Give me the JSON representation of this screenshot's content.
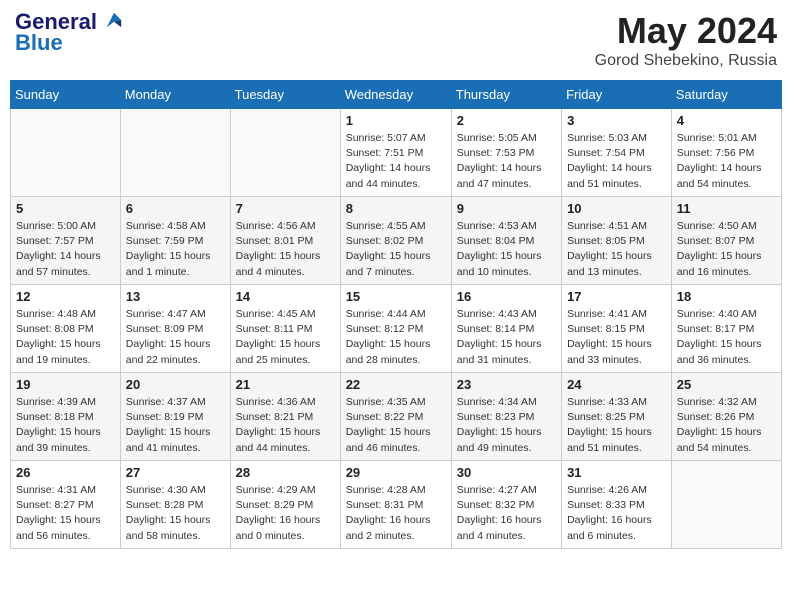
{
  "header": {
    "logo_line1": "General",
    "logo_line2": "Blue",
    "month_title": "May 2024",
    "location": "Gorod Shebekino, Russia"
  },
  "weekdays": [
    "Sunday",
    "Monday",
    "Tuesday",
    "Wednesday",
    "Thursday",
    "Friday",
    "Saturday"
  ],
  "weeks": [
    [
      {
        "day": "",
        "sunrise": "",
        "sunset": "",
        "daylight": ""
      },
      {
        "day": "",
        "sunrise": "",
        "sunset": "",
        "daylight": ""
      },
      {
        "day": "",
        "sunrise": "",
        "sunset": "",
        "daylight": ""
      },
      {
        "day": "1",
        "sunrise": "Sunrise: 5:07 AM",
        "sunset": "Sunset: 7:51 PM",
        "daylight": "Daylight: 14 hours and 44 minutes."
      },
      {
        "day": "2",
        "sunrise": "Sunrise: 5:05 AM",
        "sunset": "Sunset: 7:53 PM",
        "daylight": "Daylight: 14 hours and 47 minutes."
      },
      {
        "day": "3",
        "sunrise": "Sunrise: 5:03 AM",
        "sunset": "Sunset: 7:54 PM",
        "daylight": "Daylight: 14 hours and 51 minutes."
      },
      {
        "day": "4",
        "sunrise": "Sunrise: 5:01 AM",
        "sunset": "Sunset: 7:56 PM",
        "daylight": "Daylight: 14 hours and 54 minutes."
      }
    ],
    [
      {
        "day": "5",
        "sunrise": "Sunrise: 5:00 AM",
        "sunset": "Sunset: 7:57 PM",
        "daylight": "Daylight: 14 hours and 57 minutes."
      },
      {
        "day": "6",
        "sunrise": "Sunrise: 4:58 AM",
        "sunset": "Sunset: 7:59 PM",
        "daylight": "Daylight: 15 hours and 1 minute."
      },
      {
        "day": "7",
        "sunrise": "Sunrise: 4:56 AM",
        "sunset": "Sunset: 8:01 PM",
        "daylight": "Daylight: 15 hours and 4 minutes."
      },
      {
        "day": "8",
        "sunrise": "Sunrise: 4:55 AM",
        "sunset": "Sunset: 8:02 PM",
        "daylight": "Daylight: 15 hours and 7 minutes."
      },
      {
        "day": "9",
        "sunrise": "Sunrise: 4:53 AM",
        "sunset": "Sunset: 8:04 PM",
        "daylight": "Daylight: 15 hours and 10 minutes."
      },
      {
        "day": "10",
        "sunrise": "Sunrise: 4:51 AM",
        "sunset": "Sunset: 8:05 PM",
        "daylight": "Daylight: 15 hours and 13 minutes."
      },
      {
        "day": "11",
        "sunrise": "Sunrise: 4:50 AM",
        "sunset": "Sunset: 8:07 PM",
        "daylight": "Daylight: 15 hours and 16 minutes."
      }
    ],
    [
      {
        "day": "12",
        "sunrise": "Sunrise: 4:48 AM",
        "sunset": "Sunset: 8:08 PM",
        "daylight": "Daylight: 15 hours and 19 minutes."
      },
      {
        "day": "13",
        "sunrise": "Sunrise: 4:47 AM",
        "sunset": "Sunset: 8:09 PM",
        "daylight": "Daylight: 15 hours and 22 minutes."
      },
      {
        "day": "14",
        "sunrise": "Sunrise: 4:45 AM",
        "sunset": "Sunset: 8:11 PM",
        "daylight": "Daylight: 15 hours and 25 minutes."
      },
      {
        "day": "15",
        "sunrise": "Sunrise: 4:44 AM",
        "sunset": "Sunset: 8:12 PM",
        "daylight": "Daylight: 15 hours and 28 minutes."
      },
      {
        "day": "16",
        "sunrise": "Sunrise: 4:43 AM",
        "sunset": "Sunset: 8:14 PM",
        "daylight": "Daylight: 15 hours and 31 minutes."
      },
      {
        "day": "17",
        "sunrise": "Sunrise: 4:41 AM",
        "sunset": "Sunset: 8:15 PM",
        "daylight": "Daylight: 15 hours and 33 minutes."
      },
      {
        "day": "18",
        "sunrise": "Sunrise: 4:40 AM",
        "sunset": "Sunset: 8:17 PM",
        "daylight": "Daylight: 15 hours and 36 minutes."
      }
    ],
    [
      {
        "day": "19",
        "sunrise": "Sunrise: 4:39 AM",
        "sunset": "Sunset: 8:18 PM",
        "daylight": "Daylight: 15 hours and 39 minutes."
      },
      {
        "day": "20",
        "sunrise": "Sunrise: 4:37 AM",
        "sunset": "Sunset: 8:19 PM",
        "daylight": "Daylight: 15 hours and 41 minutes."
      },
      {
        "day": "21",
        "sunrise": "Sunrise: 4:36 AM",
        "sunset": "Sunset: 8:21 PM",
        "daylight": "Daylight: 15 hours and 44 minutes."
      },
      {
        "day": "22",
        "sunrise": "Sunrise: 4:35 AM",
        "sunset": "Sunset: 8:22 PM",
        "daylight": "Daylight: 15 hours and 46 minutes."
      },
      {
        "day": "23",
        "sunrise": "Sunrise: 4:34 AM",
        "sunset": "Sunset: 8:23 PM",
        "daylight": "Daylight: 15 hours and 49 minutes."
      },
      {
        "day": "24",
        "sunrise": "Sunrise: 4:33 AM",
        "sunset": "Sunset: 8:25 PM",
        "daylight": "Daylight: 15 hours and 51 minutes."
      },
      {
        "day": "25",
        "sunrise": "Sunrise: 4:32 AM",
        "sunset": "Sunset: 8:26 PM",
        "daylight": "Daylight: 15 hours and 54 minutes."
      }
    ],
    [
      {
        "day": "26",
        "sunrise": "Sunrise: 4:31 AM",
        "sunset": "Sunset: 8:27 PM",
        "daylight": "Daylight: 15 hours and 56 minutes."
      },
      {
        "day": "27",
        "sunrise": "Sunrise: 4:30 AM",
        "sunset": "Sunset: 8:28 PM",
        "daylight": "Daylight: 15 hours and 58 minutes."
      },
      {
        "day": "28",
        "sunrise": "Sunrise: 4:29 AM",
        "sunset": "Sunset: 8:29 PM",
        "daylight": "Daylight: 16 hours and 0 minutes."
      },
      {
        "day": "29",
        "sunrise": "Sunrise: 4:28 AM",
        "sunset": "Sunset: 8:31 PM",
        "daylight": "Daylight: 16 hours and 2 minutes."
      },
      {
        "day": "30",
        "sunrise": "Sunrise: 4:27 AM",
        "sunset": "Sunset: 8:32 PM",
        "daylight": "Daylight: 16 hours and 4 minutes."
      },
      {
        "day": "31",
        "sunrise": "Sunrise: 4:26 AM",
        "sunset": "Sunset: 8:33 PM",
        "daylight": "Daylight: 16 hours and 6 minutes."
      },
      {
        "day": "",
        "sunrise": "",
        "sunset": "",
        "daylight": ""
      }
    ]
  ]
}
